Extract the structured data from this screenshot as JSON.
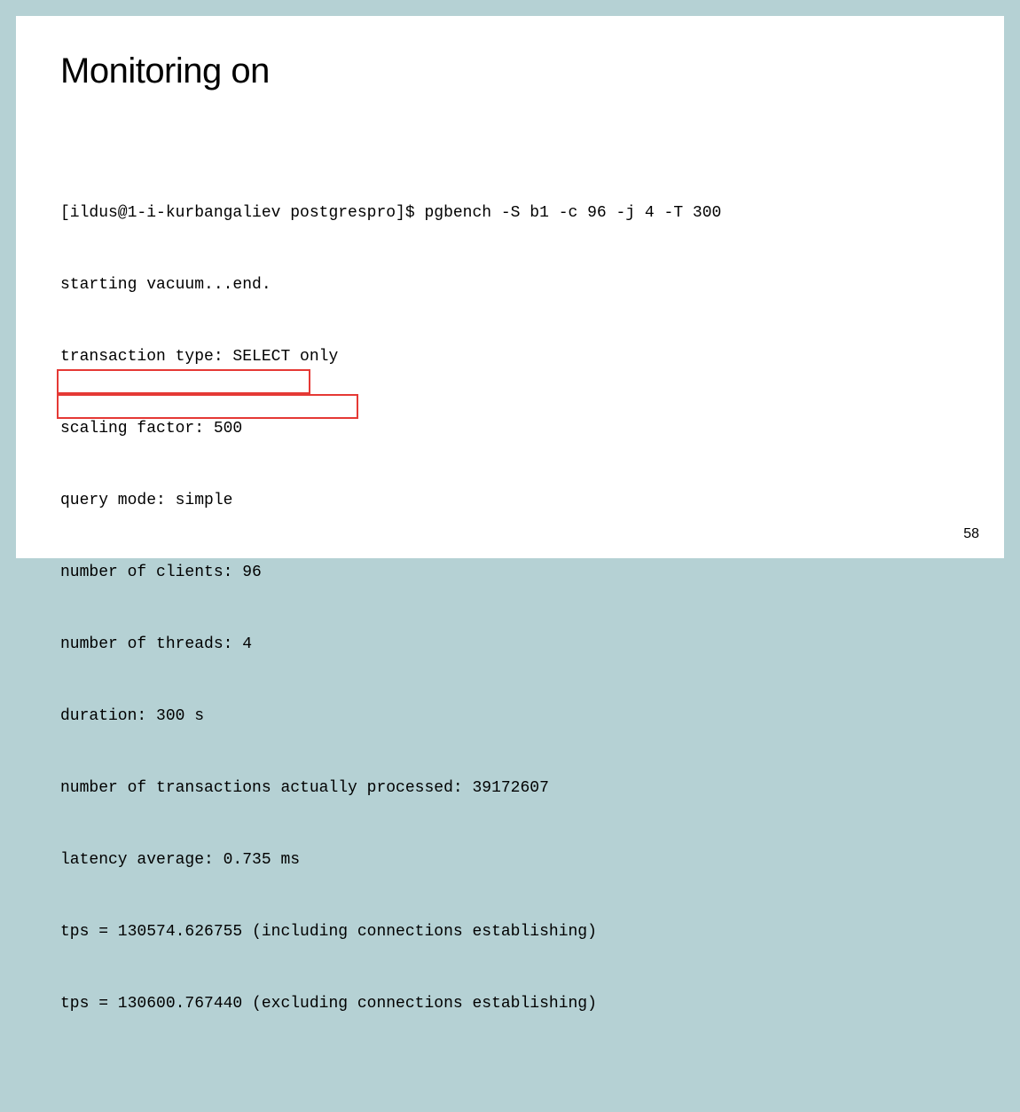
{
  "title": "Monitoring on",
  "terminal": {
    "lines": [
      "[ildus@1-i-kurbangaliev postgrespro]$ pgbench -S b1 -c 96 -j 4 -T 300",
      "starting vacuum...end.",
      "transaction type: SELECT only",
      "scaling factor: 500",
      "query mode: simple",
      "number of clients: 96",
      "number of threads: 4",
      "duration: 300 s",
      "number of transactions actually processed: 39172607",
      "latency average: 0.735 ms",
      "tps = 130574.626755 (including connections establishing)",
      "tps = 130600.767440 (excluding connections establishing)"
    ]
  },
  "page_number": "58"
}
